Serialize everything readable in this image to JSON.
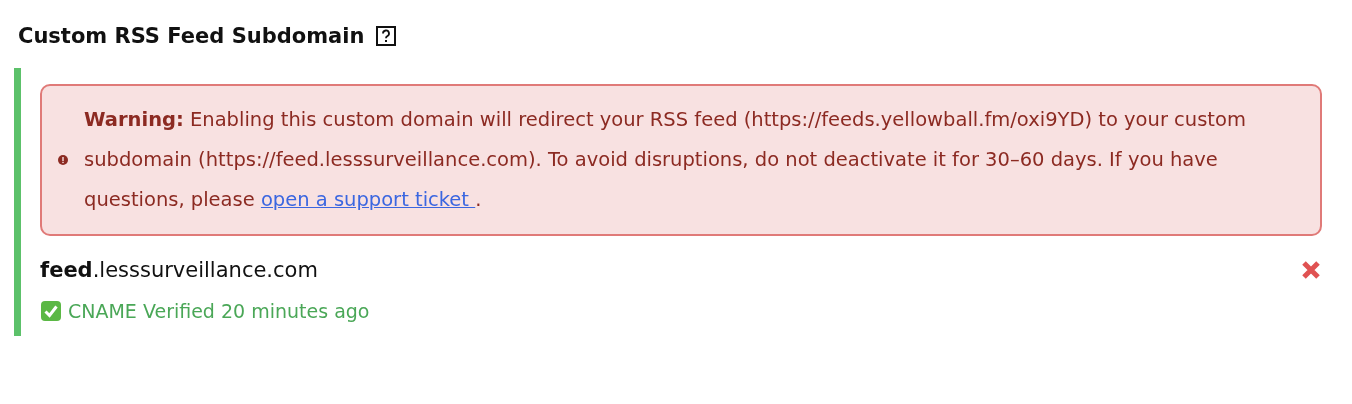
{
  "section": {
    "title": "Custom RSS Feed Subdomain"
  },
  "warning": {
    "text": "**Warning:** Enabling this custom domain will redirect your RSS feed (https://feeds.yellowball.fm/oxi9YD) to your custom subdomain (https://feed.lesssurveillance.com). To avoid disruptions, do not deactivate it for 30–60 days. If you have questions, please ",
    "link": "open a support ticket ",
    "after": "."
  },
  "domain": {
    "name": "**feed**.lesssurveillance.com",
    "status": "CNAME Verified 20 minutes ago",
    "verified": true
  }
}
